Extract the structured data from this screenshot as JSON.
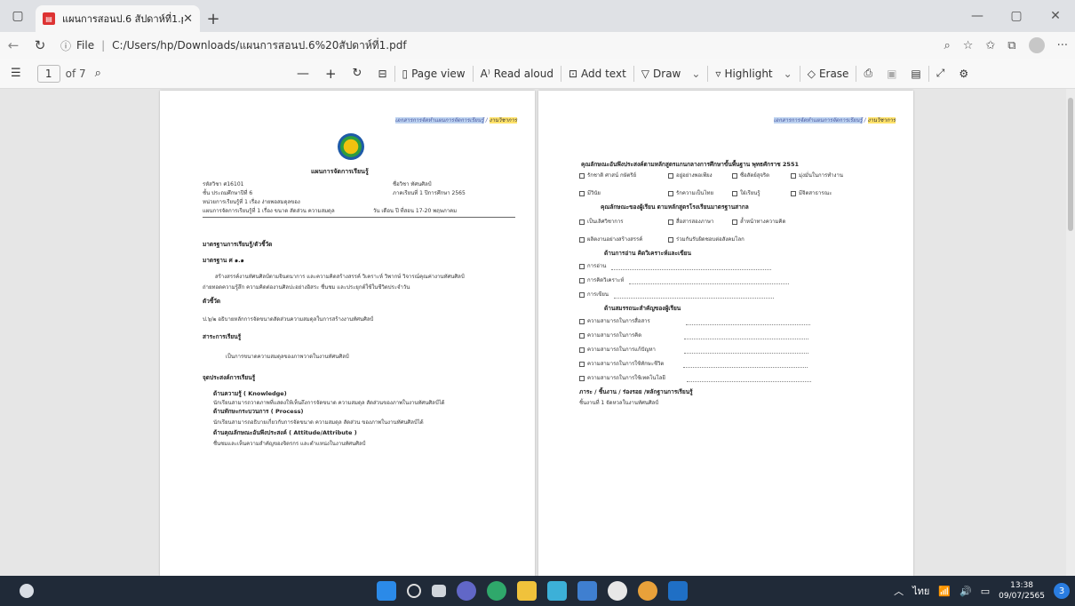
{
  "browser": {
    "tab_title": "แผนการสอนป.6 สัปดาห์ที่1.pdf",
    "url_prefix": "File",
    "url": "C:/Users/hp/Downloads/แผนการสอนป.6%20สัปดาห์ที่1.pdf"
  },
  "toolbar": {
    "page_current": "1",
    "page_total": "of 7",
    "page_view": "Page view",
    "read_aloud": "Read aloud",
    "add_text": "Add text",
    "draw": "Draw",
    "highlight": "Highlight",
    "erase": "Erase"
  },
  "doc": {
    "header_a": "เอกสารการจัดทำแผนการจัดการเรียนรู้",
    "header_b": "งานวิชาการ",
    "title": "แผนการจัดการเรียนรู้",
    "meta": [
      {
        "l": "รหัสวิชา ศ16101",
        "r": "ชื่อวิชา ทัศนศิลป์"
      },
      {
        "l": "ชั้น ประถมศึกษาปีที่ 6",
        "r": "ภาคเรียนที่ 1 ปีการศึกษา 2565"
      },
      {
        "l": "หน่วยการเรียนรู้ที่ 1 เรื่อง ง่ายพอสมดุลของ",
        "r": ""
      },
      {
        "l": "แผนการจัดการเรียนรู้ที่ 1 เรื่อง ขนาด สัดส่วน ความสมดุล",
        "r": "วัน เดือน ปี ที่สอน 17-20 พฤษภาคม"
      }
    ],
    "left_body": [
      {
        "t": "มาตรฐานการเรียนรู้/ตัวชี้วัด",
        "s": "b"
      },
      {
        "t": "มาตรฐาน  ศ ๑.๑",
        "s": "b"
      },
      {
        "t": "สร้างสรรค์งานทัศนศิลป์ตามจินตนาการ และความคิดสร้างสรรค์ วิเคราะห์ วิพากษ์ วิจารณ์คุณค่างานทัศนศิลป์",
        "s": "i"
      },
      {
        "t": "ถ่ายทอดความรู้สึก ความคิดต่องานศิลปะอย่างอิสระ ชื่นชม และประยุกต์ใช้ในชีวิตประจำวัน",
        "s": ""
      },
      {
        "t": "ตัวชี้วัด",
        "s": "b"
      },
      {
        "t": "ป.๖/๒ อธิบายหลักการจัดขนาดสัดส่วนความสมดุลในการสร้างงานทัศนศิลป์",
        "s": ""
      },
      {
        "t": "สาระการเรียนรู้",
        "s": "b"
      },
      {
        "t": "เป็นการขนาดความสมดุลของภาพวาดในงานทัศนศิลป์",
        "s": "i"
      },
      {
        "t": "จุดประสงค์การเรียนรู้",
        "s": "b"
      },
      {
        "t": "ด้านความรู้ ( Knowledge)",
        "s": "bi"
      },
      {
        "t": "นักเรียนสามารถวาดภาพที่แสดงให้เห็นถึงการจัดขนาด ความสมดุล สัดส่วนของภาพในงานทัศนศิลป์ได้",
        "s": "i"
      },
      {
        "t": "ด้านทักษะกระบวนการ ( Process)",
        "s": "bi"
      },
      {
        "t": "นักเรียนสามารถอธิบายเกี่ยวกับการจัดขนาด ความสมดุล สัดส่วน ของภาพในงานทัศนศิลป์ได้",
        "s": "i"
      },
      {
        "t": "ด้านคุณลักษณะอันพึงประสงค์  ( Attitude/Attribute )",
        "s": "bi"
      },
      {
        "t": "ชื่นชมและเห็นความสำคัญของจิตรกร และตำแหน่งในงานทัศนศิลป์",
        "s": "i"
      }
    ],
    "right": {
      "heading1": "คุณลักษณะอันพึงประสงค์ตามหลักสูตรแกนกลางการศึกษาขั้นพื้นฐาน พุทธศักราช 2551",
      "row1": [
        "รักชาติ ศาสน์ กษัตริย์",
        "อยู่อย่างพอเพียง",
        "ซื่อสัตย์สุจริต",
        "มุ่งมั่นในการทำงาน"
      ],
      "row2": [
        "มีวินัย",
        "รักความเป็นไทย",
        "ใฝ่เรียนรู้",
        "มีจิตสาธารณะ"
      ],
      "heading2": "คุณลักษณะของผู้เรียน ตามหลักสูตรโรงเรียนมาตรฐานสากล",
      "row3": [
        "เป็นเลิศวิชาการ",
        "สื่อสารสองภาษา",
        "ล้ำหน้าทางความคิด"
      ],
      "row4": [
        "ผลิตงานอย่างสร้างสรรค์",
        "ร่วมกันรับผิดชอบต่อสังคมโลก"
      ],
      "heading3": "ด้านการอ่าน คิดวิเคราะห์และเขียน",
      "read": [
        "การอ่าน",
        "การคิดวิเคราะห์",
        "การเขียน"
      ],
      "heading4": "ด้านสมรรถนะสำคัญของผู้เรียน",
      "comp": [
        "ความสามารถในการสื่อสาร",
        "ความสามารถในการคิด",
        "ความสามารถในการแก้ปัญหา",
        "ความสามารถในการใช้ทักษะชีวิต",
        "ความสามารถในการใช้เทคโนโลยี"
      ],
      "heading5": "ภาระ / ชิ้นงาน / ร่องรอย /หลักฐานการเรียนรู้",
      "task": "ชิ้นงานที่ 1 จัดหวลในงานทัศนศิลป์"
    }
  },
  "taskbar": {
    "lang": "ไทย",
    "time": "13:38",
    "date": "09/07/2565",
    "notif_count": "3"
  }
}
